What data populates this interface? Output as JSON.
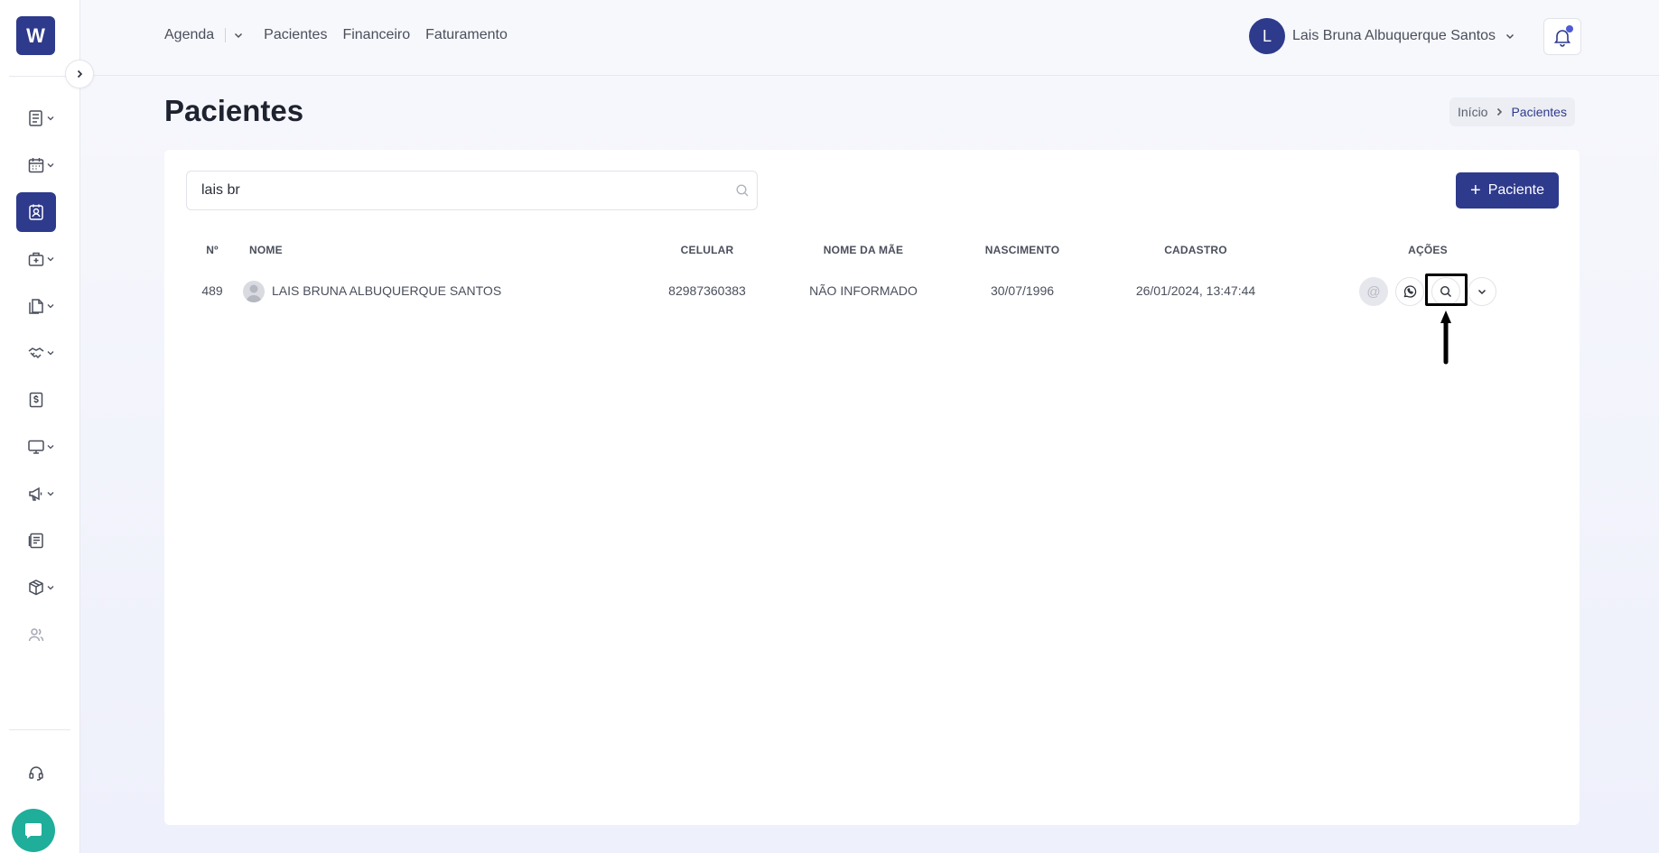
{
  "app": {
    "logo_letter": "W",
    "accent_color": "#2e3a8c"
  },
  "topnav": {
    "items": [
      "Agenda",
      "Pacientes",
      "Financeiro",
      "Faturamento"
    ]
  },
  "user": {
    "initial": "L",
    "name": "Lais Bruna Albuquerque Santos"
  },
  "page": {
    "title": "Pacientes"
  },
  "breadcrumb": {
    "home": "Início",
    "current": "Pacientes"
  },
  "search": {
    "value": "lais br",
    "placeholder": ""
  },
  "add_button": {
    "label": "Paciente"
  },
  "table": {
    "headers": [
      "Nº",
      "NOME",
      "CELULAR",
      "NOME DA MÃE",
      "NASCIMENTO",
      "CADASTRO",
      "AÇÕES"
    ],
    "rows": [
      {
        "numero": "489",
        "nome": "LAIS BRUNA ALBUQUERQUE SANTOS",
        "celular": "82987360383",
        "mae": "NÃO INFORMADO",
        "nascimento": "30/07/1996",
        "cadastro": "26/01/2024, 13:47:44"
      }
    ]
  },
  "sidebar": {
    "icons": [
      "list-icon",
      "calendar-icon",
      "patient-contact-icon",
      "medical-bag-icon",
      "documents-icon",
      "handshake-icon",
      "dollar-document-icon",
      "monitor-icon",
      "megaphone-icon",
      "report-icon",
      "package-icon",
      "users-icon",
      "headset-icon",
      "chat-icon"
    ]
  }
}
